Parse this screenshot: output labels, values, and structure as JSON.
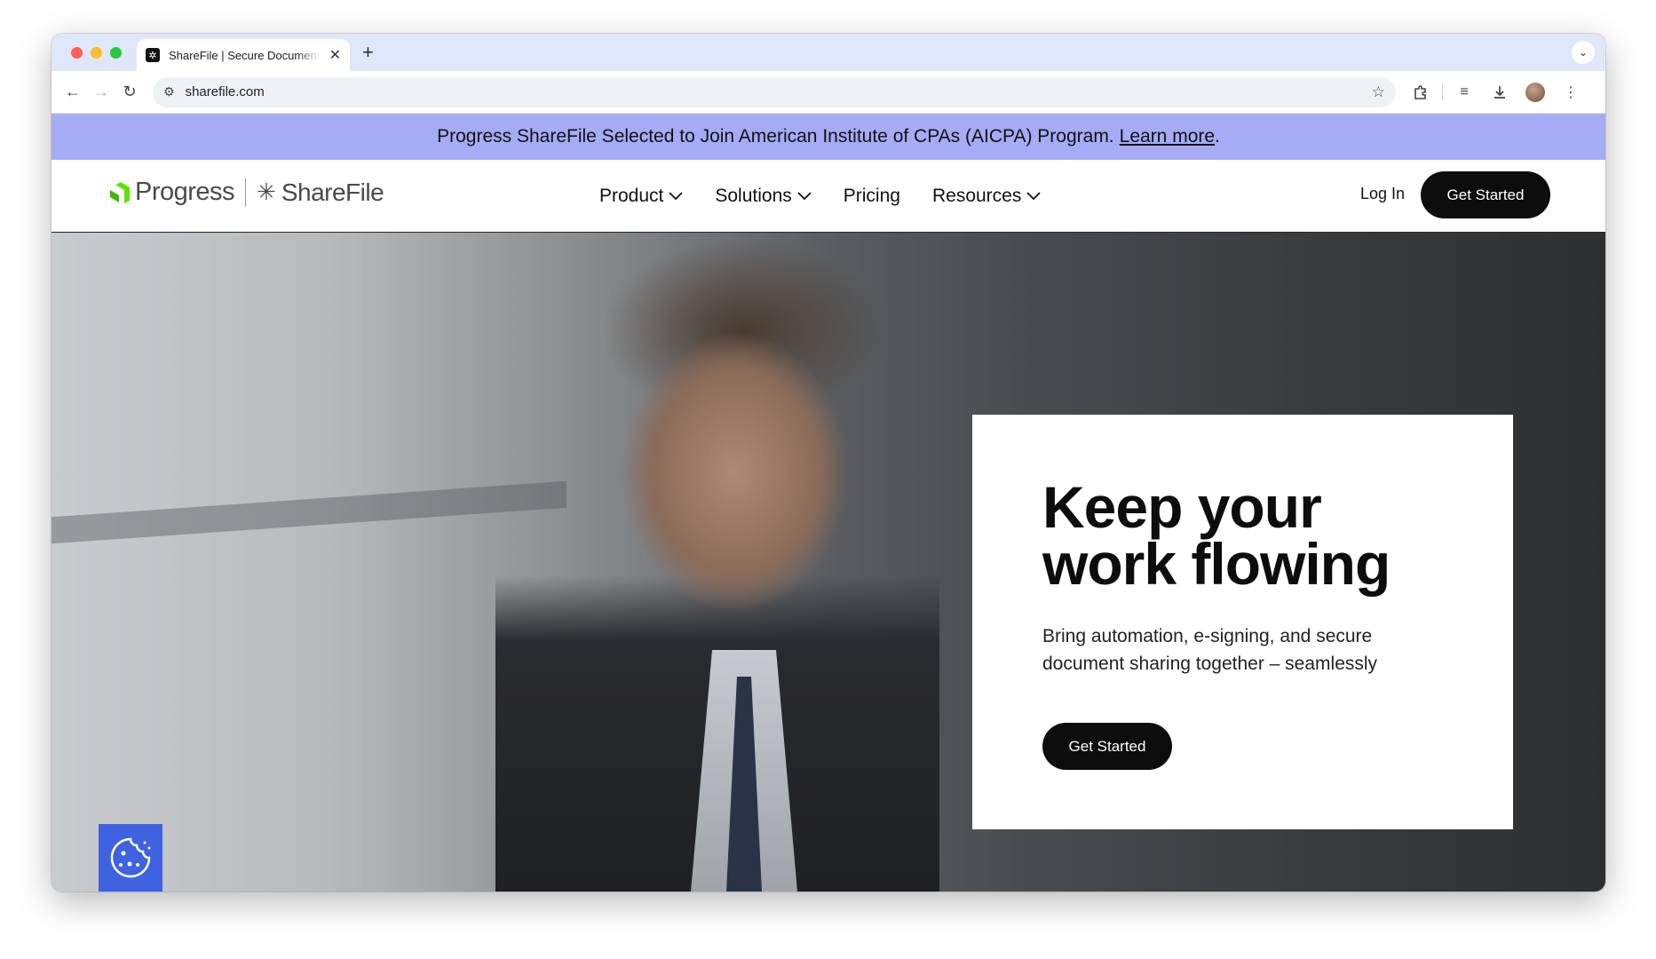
{
  "browser": {
    "tab_title": "ShareFile | Secure Document",
    "tab_close": "✕",
    "new_tab": "+",
    "url": "sharefile.com"
  },
  "banner": {
    "text": "Progress ShareFile Selected to Join American Institute of CPAs (AICPA) Program.",
    "link": "Learn more",
    "trailing": "."
  },
  "header": {
    "logo_progress": "Progress",
    "logo_sharefile": "ShareFile",
    "nav": [
      {
        "label": "Product",
        "has_dropdown": true
      },
      {
        "label": "Solutions",
        "has_dropdown": true
      },
      {
        "label": "Pricing",
        "has_dropdown": false
      },
      {
        "label": "Resources",
        "has_dropdown": true
      }
    ],
    "login": "Log In",
    "cta": "Get Started"
  },
  "hero": {
    "title": "Keep your work flowing",
    "subtitle": "Bring automation, e-signing, and secure document sharing together – seamlessly",
    "cta": "Get Started"
  },
  "colors": {
    "banner_bg": "#a5acf5",
    "cta_bg": "#0d0d0d",
    "cookie_bg": "#3f63e0",
    "progress_green": "#5ce500"
  },
  "icons": {
    "cookie": "cookie-icon"
  }
}
